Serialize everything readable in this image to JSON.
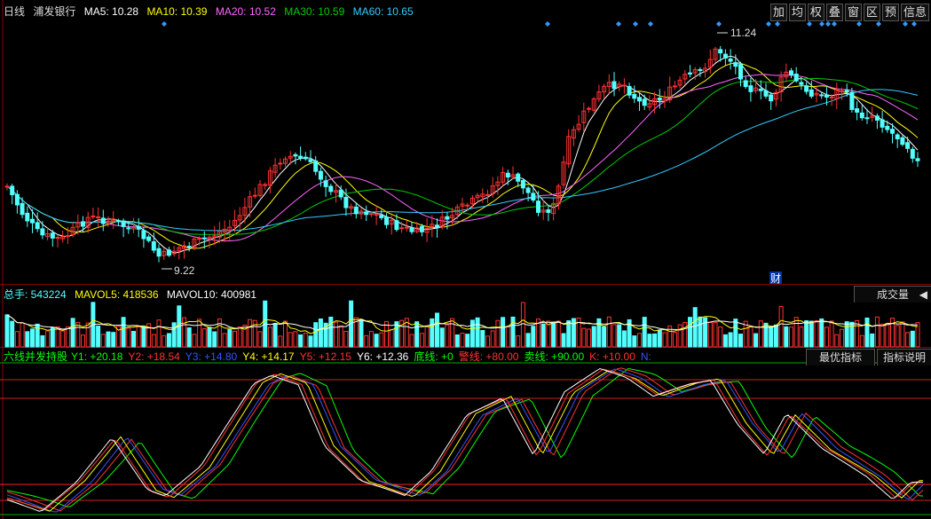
{
  "header": {
    "period": "日线",
    "stock_name": "浦发银行",
    "ma": [
      {
        "label": "MA5: 10.28",
        "color": "#ffffff"
      },
      {
        "label": "MA10: 10.39",
        "color": "#ffff00"
      },
      {
        "label": "MA20: 10.52",
        "color": "#ff66ff"
      },
      {
        "label": "MA30: 10.59",
        "color": "#00cc00"
      },
      {
        "label": "MA60: 10.65",
        "color": "#33ccff"
      }
    ]
  },
  "toolbar": [
    "加",
    "均",
    "权",
    "叠",
    "窗",
    "区",
    "预",
    "信息"
  ],
  "price_marks": {
    "high_label": "11.24",
    "low_label": "9.22",
    "finance_tag": "财"
  },
  "volume_panel": {
    "total_label": "总手: 543224",
    "mavol5_label": "MAVOL5: 418536",
    "mavol10_label": "MAVOL10: 400981",
    "dropdown_label": "成交量",
    "colors": {
      "up": "#ff3232",
      "down": "#54ffff"
    }
  },
  "indicator_panel": {
    "name": "六线并发持股",
    "values": [
      {
        "label": "Y1: +20.18",
        "color": "#00ff00"
      },
      {
        "label": "Y2: +18.54",
        "color": "#ff3232"
      },
      {
        "label": "Y3: +14.80",
        "color": "#3355ff"
      },
      {
        "label": "Y4: +14.17",
        "color": "#ffff00"
      },
      {
        "label": "Y5: +12.15",
        "color": "#ff3232"
      },
      {
        "label": "Y6: +12.36",
        "color": "#ffffff"
      },
      {
        "label": "底线: +0",
        "color": "#00ff00"
      },
      {
        "label": "警线: +80.00",
        "color": "#ff3232"
      },
      {
        "label": "卖线: +90.00",
        "color": "#00ff00"
      },
      {
        "label": "K: +10.00",
        "color": "#ff3232"
      },
      {
        "label": "N:",
        "color": "#3355ff"
      }
    ],
    "btn_best": "最优指标",
    "btn_help": "指标说明"
  },
  "colors": {
    "bg": "#000000",
    "grid_red": "#8b0000",
    "up": "#ff3232",
    "down": "#54ffff",
    "marker": "#3399ff"
  }
}
